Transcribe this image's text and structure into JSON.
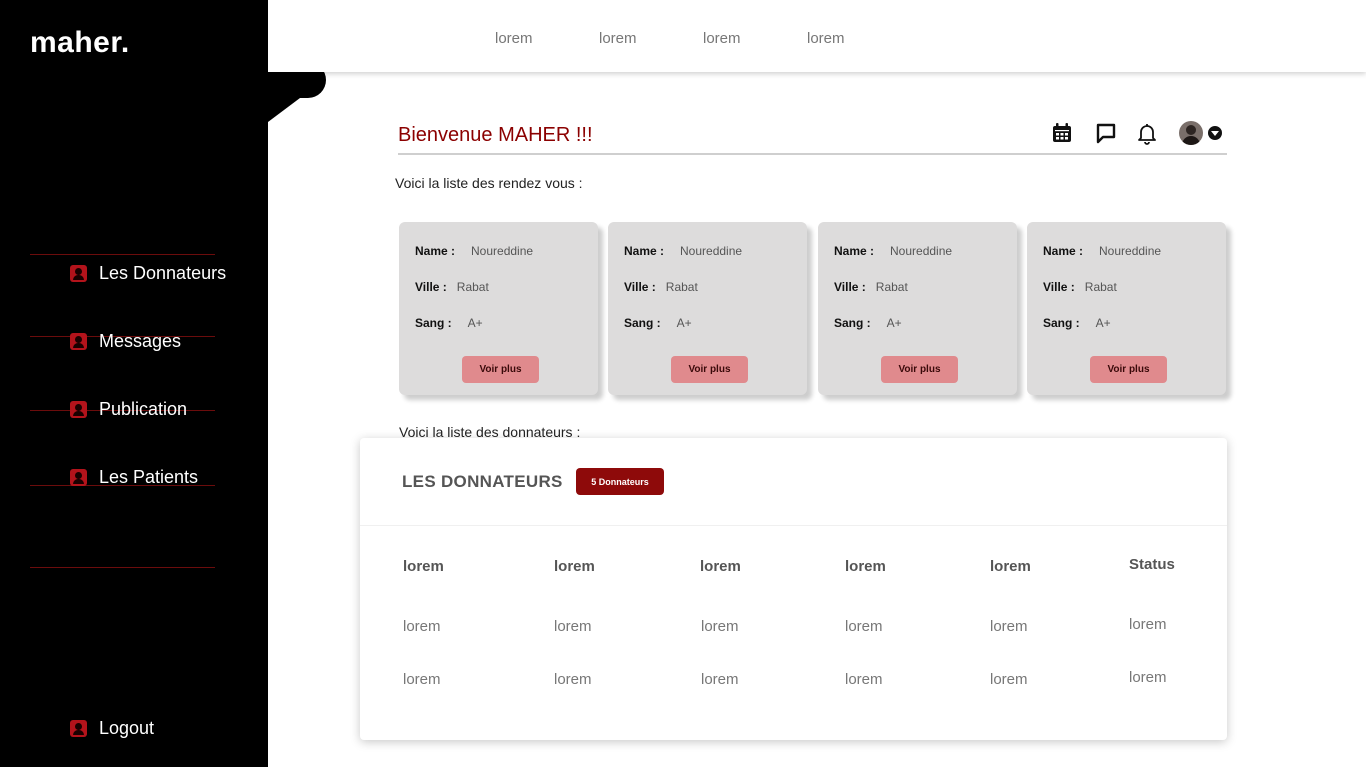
{
  "brand": {
    "logo": "maher."
  },
  "sidebar": {
    "items": [
      {
        "label": "Les Donnateurs",
        "icon": "user-icon"
      },
      {
        "label": "Messages",
        "icon": "user-icon"
      },
      {
        "label": "Publication",
        "icon": "user-icon"
      },
      {
        "label": "Les Patients",
        "icon": "user-icon"
      }
    ],
    "logout": {
      "label": "Logout",
      "icon": "user-icon"
    }
  },
  "topnav": {
    "links": [
      "lorem",
      "lorem",
      "lorem",
      "lorem"
    ]
  },
  "header": {
    "welcome": "Bienvenue MAHER !!!",
    "icons": [
      "calendar-icon",
      "chat-icon",
      "bell-icon",
      "avatar",
      "chevron-down-icon"
    ]
  },
  "appointments": {
    "intro": "Voici la liste des rendez vous  :",
    "cards": [
      {
        "name_label": "Name :",
        "name": "Noureddine",
        "city_label": "Ville :",
        "city": "Rabat",
        "blood_label": "Sang  :",
        "blood": "A+",
        "button": "Voir plus"
      },
      {
        "name_label": "Name :",
        "name": "Noureddine",
        "city_label": "Ville :",
        "city": "Rabat",
        "blood_label": "Sang  :",
        "blood": "A+",
        "button": "Voir plus"
      },
      {
        "name_label": "Name :",
        "name": "Noureddine",
        "city_label": "Ville :",
        "city": "Rabat",
        "blood_label": "Sang  :",
        "blood": "A+",
        "button": "Voir plus"
      },
      {
        "name_label": "Name :",
        "name": "Noureddine",
        "city_label": "Ville :",
        "city": "Rabat",
        "blood_label": "Sang  :",
        "blood": "A+",
        "button": "Voir plus"
      }
    ]
  },
  "donors": {
    "intro": "Voici la liste des donnateurs :",
    "title": "LES DONNATEURS",
    "badge": "5 Donnateurs",
    "columns": [
      "lorem",
      "lorem",
      "lorem",
      "lorem",
      "lorem",
      "Status"
    ],
    "rows": [
      [
        "lorem",
        "lorem",
        "lorem",
        "lorem",
        "lorem",
        "lorem"
      ],
      [
        "lorem",
        "lorem",
        "lorem",
        "lorem",
        "lorem",
        "lorem"
      ]
    ]
  },
  "colors": {
    "accent": "#8b0000",
    "sidebar": "#000000",
    "card": "#dddcdc",
    "button": "#e08a8d"
  }
}
